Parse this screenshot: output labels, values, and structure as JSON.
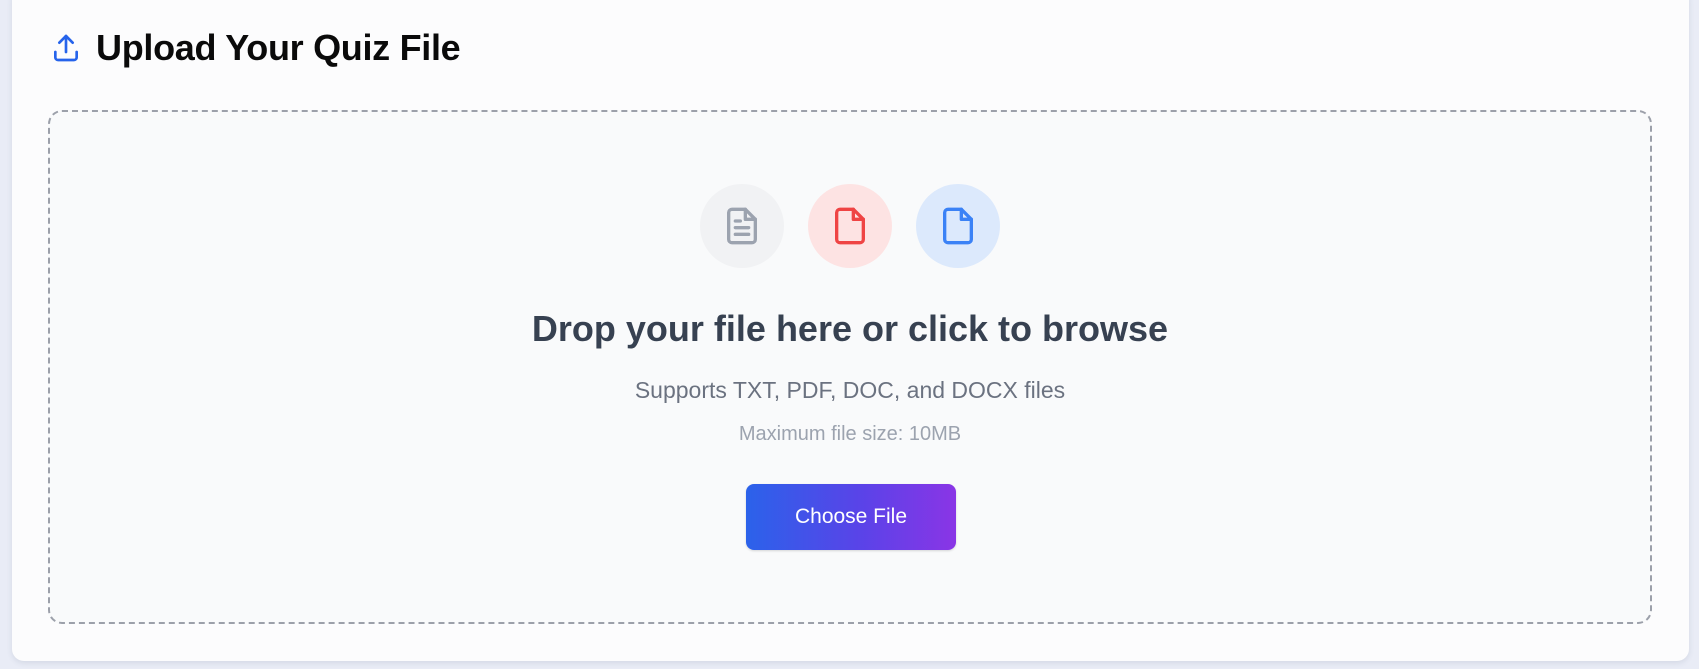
{
  "header": {
    "title": "Upload Your Quiz File",
    "icon": "upload-icon"
  },
  "dropzone": {
    "file_types": [
      {
        "icon": "file-text-icon",
        "color": "#9ca3af",
        "background": "#f1f2f4"
      },
      {
        "icon": "file-pdf-icon",
        "color": "#ef4444",
        "background": "#fde3e3"
      },
      {
        "icon": "file-doc-icon",
        "color": "#3b82f6",
        "background": "#dce9fc"
      }
    ],
    "title": "Drop your file here or click to browse",
    "supports": "Supports TXT, PDF, DOC, and DOCX files",
    "max_size": "Maximum file size: 10MB",
    "button_label": "Choose File"
  },
  "colors": {
    "accent_start": "#2b62ea",
    "accent_end": "#8a35e6",
    "upload_icon": "#2563eb"
  }
}
